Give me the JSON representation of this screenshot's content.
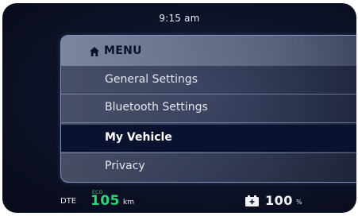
{
  "status": {
    "time": "9:15 am"
  },
  "menu": {
    "title": "MENU",
    "items": [
      {
        "label": "General Settings",
        "selected": false
      },
      {
        "label": "Bluetooth Settings",
        "selected": false
      },
      {
        "label": "My Vehicle",
        "selected": true
      },
      {
        "label": "Privacy",
        "selected": false
      }
    ]
  },
  "footer": {
    "dte_label": "DTE",
    "mode": "ECO",
    "range_value": "105",
    "range_unit": "km",
    "battery_value": "100",
    "battery_unit": "%"
  },
  "colors": {
    "accent_green": "#2fd476",
    "selected_bg": "#0b1230",
    "screen_bg": "#0c1126",
    "panel_border": "#7e8fc0"
  },
  "icons": [
    "home-icon",
    "car-battery-icon"
  ]
}
